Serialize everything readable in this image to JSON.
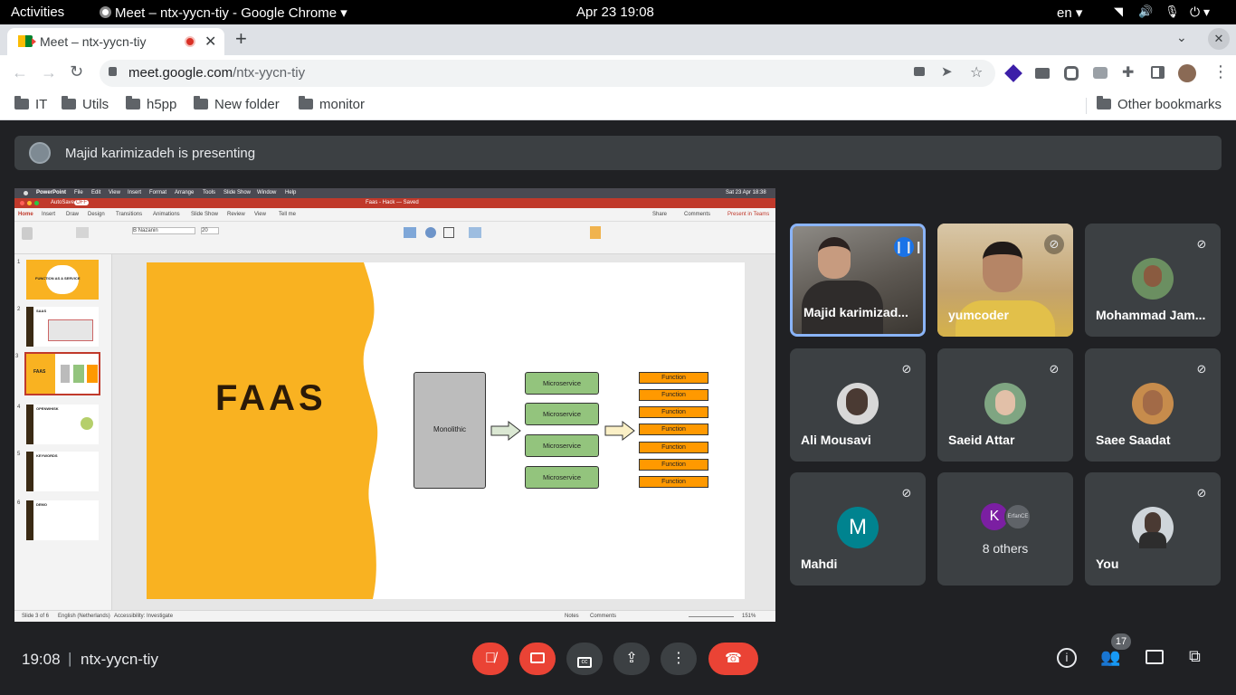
{
  "topbar": {
    "activities": "Activities",
    "app_menu": "Meet – ntx-yycn-tiy - Google Chrome",
    "clock": "Apr 23  19:08",
    "lang": "en"
  },
  "chrome": {
    "tab_title": "Meet – ntx-yycn-tiy",
    "url_host": "meet.google.com",
    "url_path": "/ntx-yycn-tiy",
    "bookmarks": [
      "IT",
      "Utils",
      "h5pp",
      "New folder",
      "monitor"
    ],
    "other_bookmarks": "Other bookmarks"
  },
  "meet": {
    "presenting_text": "Majid karimizadeh is presenting",
    "participants": [
      {
        "name": "Majid karimizad...",
        "muted": false,
        "speaking": true
      },
      {
        "name": "yumcoder",
        "muted": true
      },
      {
        "name": "Mohammad Jam...",
        "muted": true
      },
      {
        "name": "Ali Mousavi",
        "muted": true
      },
      {
        "name": "Saeid Attar",
        "muted": true
      },
      {
        "name": "Saee Saadat",
        "muted": true
      },
      {
        "name": "Mahdi",
        "muted": true,
        "initial": "M"
      },
      {
        "name": "8 others",
        "muted": false,
        "initial": "K"
      },
      {
        "name": "You",
        "muted": true
      }
    ],
    "others_badge": "ErfanCE",
    "time": "19:08",
    "separator": "|",
    "meeting_code": "ntx-yycn-tiy",
    "people_count": "17"
  },
  "slide": {
    "app_menu": [
      "PowerPoint",
      "File",
      "Edit",
      "View",
      "Insert",
      "Format",
      "Arrange",
      "Tools",
      "Slide Show",
      "Window",
      "Help"
    ],
    "mac_clock": "Sat 23 Apr  18:38",
    "autosave": "AutoSave",
    "autosave_state": "OFF",
    "doc_title": "Faas - Hack — Saved",
    "ribbon_tabs": [
      "Home",
      "Insert",
      "Draw",
      "Design",
      "Transitions",
      "Animations",
      "Slide Show",
      "Review",
      "View",
      "Tell me"
    ],
    "share": "Share",
    "comments": "Comments",
    "present_teams": "Present in Teams",
    "font_name": "B Nazanin",
    "font_size": "20",
    "title": "FAAS",
    "monolithic": "Monolithic",
    "microservices": [
      "Microservice",
      "Microservice",
      "Microservice",
      "Microservice"
    ],
    "functions": [
      "Function",
      "Function",
      "Function",
      "Function",
      "Function",
      "Function",
      "Function"
    ],
    "thumb_numbers": [
      "1",
      "2",
      "3",
      "4",
      "5",
      "6"
    ],
    "thumb_titles": [
      "FUNCTION AS A SERVICE",
      "SAAS",
      "FAAS",
      "OPENWHISK",
      "KEYWORDS",
      "DEMO"
    ],
    "status_left": "Slide 3 of 6",
    "status_lang": "English (Netherlands)",
    "status_access": "Accessibility: Investigate",
    "status_notes": "Notes",
    "status_comments": "Comments",
    "zoom": "151%"
  },
  "colors": {
    "accent_orange": "#f9b221",
    "green_box": "#93c47d",
    "function_orange": "#ff9900",
    "meet_red": "#ea4335",
    "meet_blue": "#8ab4f8"
  }
}
